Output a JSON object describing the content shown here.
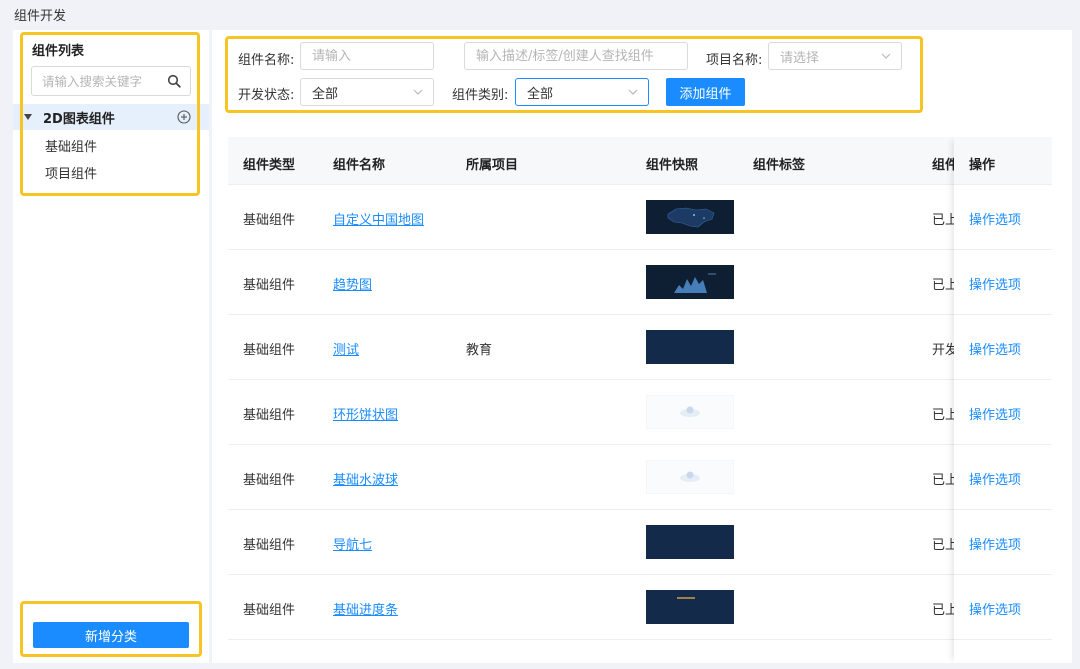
{
  "page_title": "组件开发",
  "sidebar": {
    "title": "组件列表",
    "search_placeholder": "请输入搜索关键字",
    "tree_root": "2D图表组件",
    "tree_children": [
      "基础组件",
      "项目组件"
    ],
    "new_category_label": "新增分类"
  },
  "filters": {
    "name_label": "组件名称:",
    "name_placeholder": "请输入",
    "desc_placeholder": "输入描述/标签/创建人查找组件",
    "project_label": "项目名称:",
    "project_placeholder": "请选择",
    "status_label": "开发状态:",
    "status_value": "全部",
    "category_label": "组件类别:",
    "category_value": "全部",
    "add_button": "添加组件"
  },
  "table": {
    "columns": [
      "组件类型",
      "组件名称",
      "所属项目",
      "组件快照",
      "组件标签",
      "组件",
      "操作"
    ],
    "rows": [
      {
        "type": "基础组件",
        "name": "自定义中国地图",
        "project": "",
        "status": "已上",
        "action": "操作选项",
        "snapshot": "china-map-thumbnail"
      },
      {
        "type": "基础组件",
        "name": "趋势图",
        "project": "",
        "status": "已上",
        "action": "操作选项",
        "snapshot": "trend-chart-thumbnail"
      },
      {
        "type": "基础组件",
        "name": "测试",
        "project": "教育",
        "status": "开发",
        "action": "操作选项",
        "snapshot": "blank-dark-thumbnail"
      },
      {
        "type": "基础组件",
        "name": "环形饼状图",
        "project": "",
        "status": "已上",
        "action": "操作选项",
        "snapshot": "ring-pie-thumbnail"
      },
      {
        "type": "基础组件",
        "name": "基础水波球",
        "project": "",
        "status": "已上",
        "action": "操作选项",
        "snapshot": "water-ball-thumbnail"
      },
      {
        "type": "基础组件",
        "name": "导航七",
        "project": "",
        "status": "已上",
        "action": "操作选项",
        "snapshot": "navigation-thumbnail"
      },
      {
        "type": "基础组件",
        "name": "基础进度条",
        "project": "",
        "status": "已上",
        "action": "操作选项",
        "snapshot": "progress-bar-thumbnail"
      }
    ]
  },
  "colors": {
    "accent": "#1a8cff",
    "highlight": "#f6c524",
    "thumb_dark": "#142a4a"
  }
}
